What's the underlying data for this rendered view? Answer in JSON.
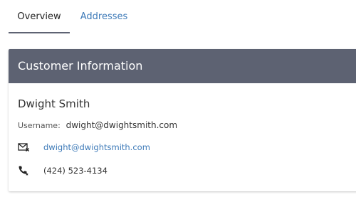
{
  "tabs": [
    {
      "label": "Overview",
      "active": true
    },
    {
      "label": "Addresses",
      "active": false
    }
  ],
  "card": {
    "title": "Customer Information",
    "name": "Dwight Smith",
    "username_label": "Username:",
    "username": "dwight@dwightsmith.com",
    "email": {
      "icon": "email-icon",
      "value": "dwight@dwightsmith.com"
    },
    "phone": {
      "icon": "phone-icon",
      "value": "(424) 523-4134"
    }
  },
  "colors": {
    "header_bg": "#5d6272",
    "link": "#3d7ab8",
    "tab_underline": "#5e6373"
  }
}
